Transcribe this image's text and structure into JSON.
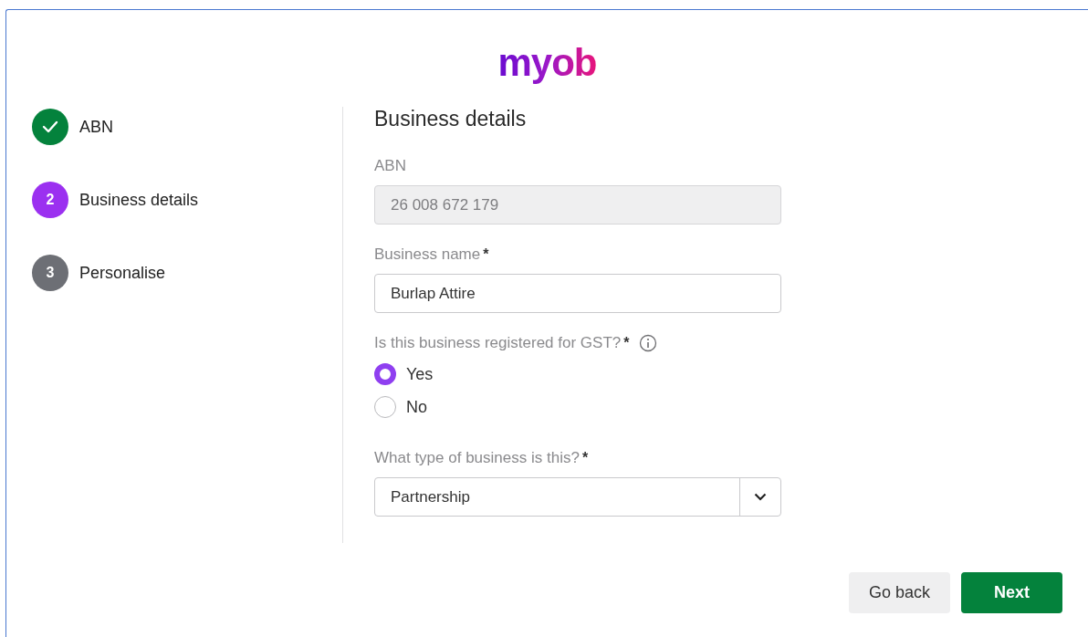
{
  "logo": "myob",
  "steps": [
    {
      "label": "ABN",
      "completed": true,
      "selected": false
    },
    {
      "number": "2",
      "label": "Business details",
      "completed": false,
      "selected": true
    },
    {
      "number": "3",
      "label": "Personalise",
      "completed": false,
      "selected": false
    }
  ],
  "form": {
    "title": "Business details",
    "fields": [
      {
        "kind": "text",
        "label": "ABN",
        "value": "26 008 672 179",
        "disabled": true
      },
      {
        "kind": "text",
        "label": "Business name",
        "marker": "*",
        "value": "Burlap Attire",
        "disabled": false
      },
      {
        "kind": "radio",
        "label": "Is this business registered for GST?",
        "marker": "*",
        "info": true,
        "options": [
          {
            "label": "Yes",
            "selected": true
          },
          {
            "label": "No",
            "selected": false
          }
        ]
      },
      {
        "kind": "select",
        "label": "What type of business is this?",
        "marker": "*",
        "value": "Partnership"
      }
    ]
  },
  "buttons": [
    {
      "label": "Go back",
      "kind": "secondary"
    },
    {
      "label": "Next",
      "kind": "primary"
    }
  ]
}
